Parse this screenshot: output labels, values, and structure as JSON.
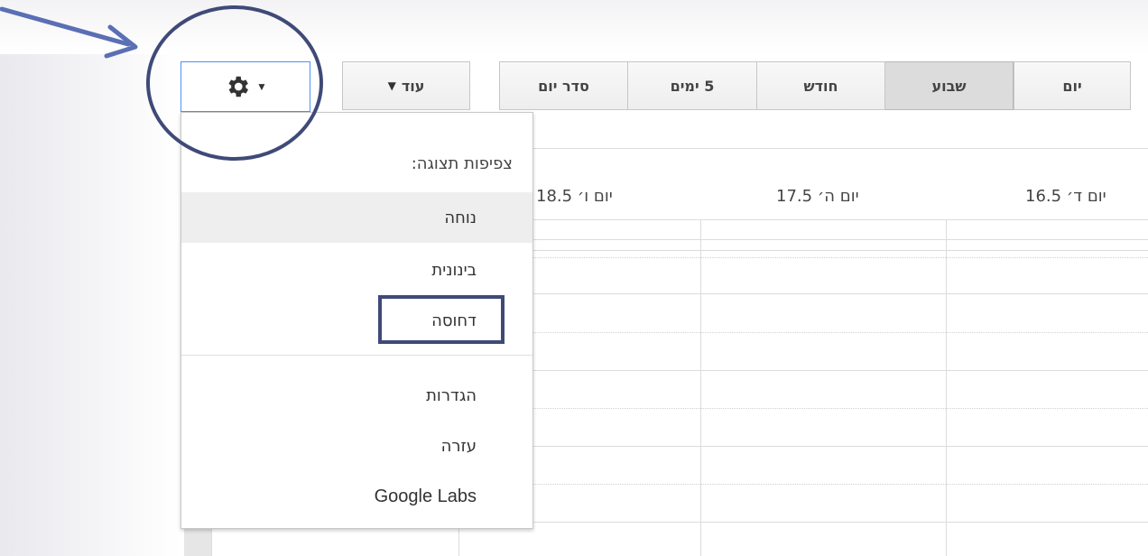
{
  "toolbar": {
    "tabs": [
      {
        "label": "יום"
      },
      {
        "label": "שבוע"
      },
      {
        "label": "חודש"
      },
      {
        "label": "5 ימים"
      },
      {
        "label": "סדר יום"
      }
    ],
    "more_label": "עוד",
    "settings_icon": "gear-icon"
  },
  "calendar": {
    "day_headers": [
      "יום ד׳ 16.5",
      "יום ה׳ 17.5",
      "יום ו׳ 18.5"
    ]
  },
  "menu": {
    "density_header": "צפיפות תצוגה:",
    "density_options": [
      "נוחה",
      "בינונית",
      "דחוסה"
    ],
    "items": [
      "הגדרות",
      "עזרה",
      "Google Labs"
    ]
  },
  "colors": {
    "annotation": "#3f4a78",
    "focus_border": "#4d90fe",
    "arrow": "#5a6fb4"
  }
}
